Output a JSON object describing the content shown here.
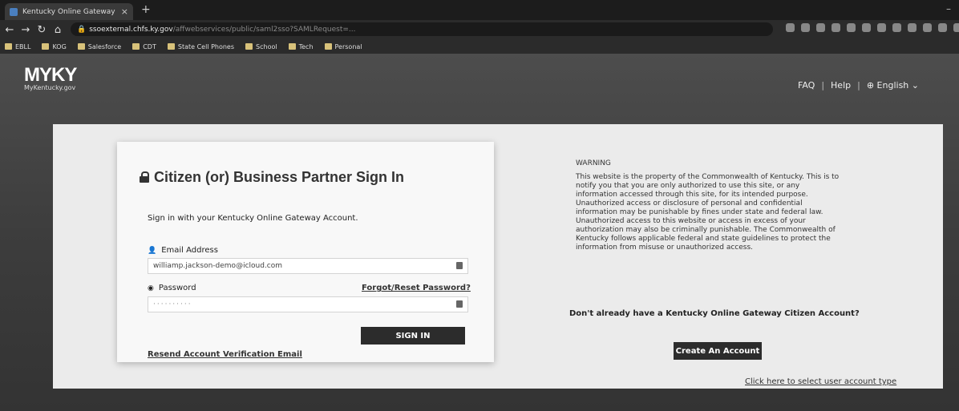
{
  "browser": {
    "tab_title": "Kentucky Online Gateway",
    "tab_close": "×",
    "new_tab": "+",
    "minimize": "–",
    "url_main": "ssoexternal.chfs.ky.gov",
    "url_rest": "/affwebservices/public/saml2sso?SAMLRequest=...",
    "bookmarks": [
      "EBLL",
      "KOG",
      "Salesforce",
      "CDT",
      "State Cell Phones",
      "School",
      "Tech",
      "Personal"
    ]
  },
  "header": {
    "logo_main": "MYKY",
    "logo_sub": "MyKentucky.gov",
    "faq": "FAQ",
    "help": "Help",
    "language": "English",
    "separator": "|"
  },
  "signin": {
    "title": "Citizen (or) Business Partner Sign In",
    "subtitle": "Sign in with your Kentucky Online Gateway Account.",
    "email_label": "Email Address",
    "email_value": "williamp.jackson-demo@icloud.com",
    "password_label": "Password",
    "password_value": "··········",
    "forgot_link": "Forgot/Reset Password?",
    "signin_button": "SIGN IN",
    "resend_link": "Resend Account Verification Email"
  },
  "warning": {
    "heading": "WARNING",
    "text": "This website is the property of the Commonwealth of Kentucky. This is to notify you that you are only authorized to use this site, or any information accessed through this site, for its intended purpose. Unauthorized access or disclosure of personal and confidential information may be punishable by fines under state and federal law. Unauthorized access to this website or access in excess of your authorization may also be criminally punishable. The Commonwealth of Kentucky follows applicable federal and state guidelines to protect the information from misuse or unauthorized access."
  },
  "register": {
    "prompt": "Don't already have a Kentucky Online Gateway Citizen Account?",
    "create_button": "Create An Account",
    "select_type_link": "Click here to select user account type"
  }
}
